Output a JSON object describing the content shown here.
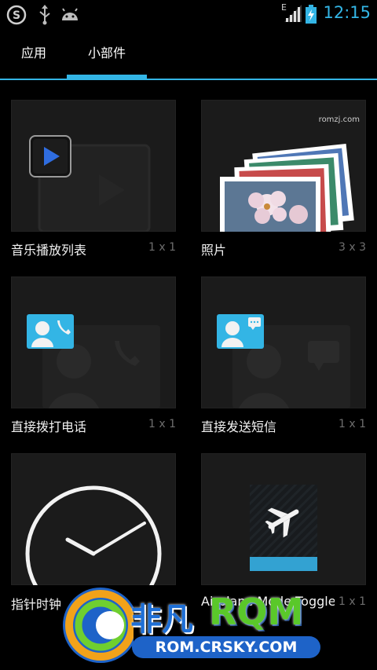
{
  "status_bar": {
    "time": "12:15",
    "icons": [
      "s-logo-icon",
      "usb-icon",
      "android-icon",
      "signal-icon",
      "battery-icon"
    ],
    "network_label": "E"
  },
  "tabs": [
    {
      "label": "应用",
      "selected": false
    },
    {
      "label": "小部件",
      "selected": true
    }
  ],
  "widgets": [
    {
      "name": "音乐播放列表",
      "size": "1 x 1",
      "icon": "music-play-icon"
    },
    {
      "name": "照片",
      "size": "3 x 3",
      "icon": "photo-stack-icon"
    },
    {
      "name": "直接拨打电话",
      "size": "1 x 1",
      "icon": "contact-call-icon"
    },
    {
      "name": "直接发送短信",
      "size": "1 x 1",
      "icon": "contact-sms-icon"
    },
    {
      "name": "指针时钟",
      "size": "",
      "icon": "analog-clock-icon"
    },
    {
      "name": "Airplane Mode Toggle",
      "size": "1 x 1",
      "icon": "airplane-icon"
    }
  ],
  "watermarks": {
    "corner": "romzj.com",
    "brand_cn": "非凡",
    "brand_en": "RQM",
    "site": "ROM.CRSKY.COM"
  },
  "colors": {
    "accent": "#33b5e5",
    "background": "#000000",
    "card": "#1b1b1b"
  }
}
